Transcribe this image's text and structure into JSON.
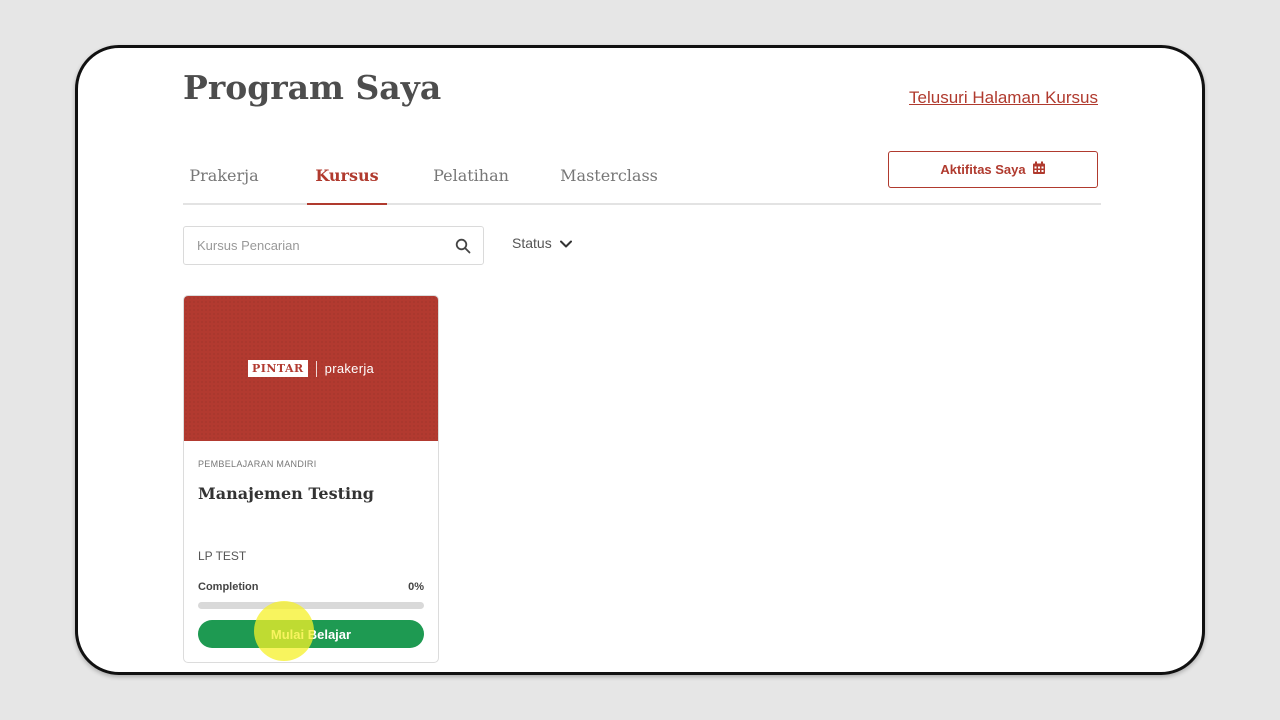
{
  "header": {
    "title": "Program Saya",
    "browse_link": "Telusuri Halaman Kursus",
    "activity_button": "Aktifitas Saya"
  },
  "tabs": [
    {
      "label": "Prakerja",
      "active": false
    },
    {
      "label": "Kursus",
      "active": true
    },
    {
      "label": "Pelatihan",
      "active": false
    },
    {
      "label": "Masterclass",
      "active": false
    }
  ],
  "filters": {
    "search_placeholder": "Kursus Pencarian",
    "search_value": "",
    "status_label": "Status"
  },
  "courses": [
    {
      "brand_primary": "PINTAR",
      "brand_secondary": "prakerja",
      "category": "PEMBELAJARAN MANDIRI",
      "title": "Manajemen Testing",
      "provider": "LP TEST",
      "completion_label": "Completion",
      "completion_text": "0%",
      "completion_fraction": 0,
      "action_label": "Mulai Belajar"
    }
  ],
  "colors": {
    "brand": "#b03a2e",
    "success": "#1e9a52"
  },
  "icons": {
    "search": "search-icon",
    "calendar": "calendar-icon",
    "chevron": "chevron-down-icon",
    "chat": "chat-bubble-icon"
  }
}
